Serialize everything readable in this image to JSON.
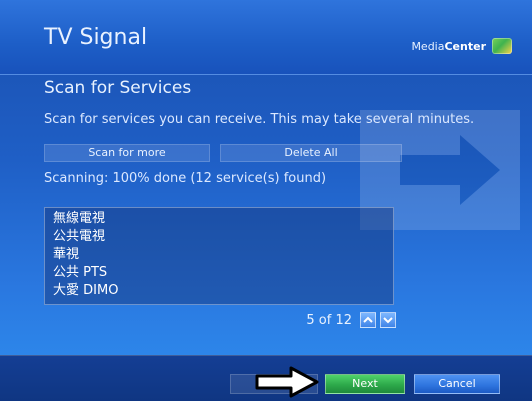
{
  "app": {
    "title": "TV Signal",
    "brand_prefix": "Media",
    "brand_bold": "Center"
  },
  "section": {
    "title": "Scan for Services",
    "description": "Scan for services you can receive. This may take several minutes.",
    "scan_button_label": "Scan for more",
    "delete_button_label": "Delete All",
    "status": "Scanning: 100% done (12 service(s) found)"
  },
  "list": {
    "items": [
      "無線電視",
      "公共電視",
      "華視",
      "公共 PTS",
      "大愛 DIMO"
    ]
  },
  "pager": {
    "text": "5 of 12",
    "up_icon": "chevron-up-icon",
    "down_icon": "chevron-down-icon"
  },
  "footer": {
    "next_label": "Next",
    "cancel_label": "Cancel"
  },
  "colors": {
    "next_green": "#2da94a",
    "cancel_blue": "#2d73dd",
    "header_blue": "#1d5ec7"
  }
}
